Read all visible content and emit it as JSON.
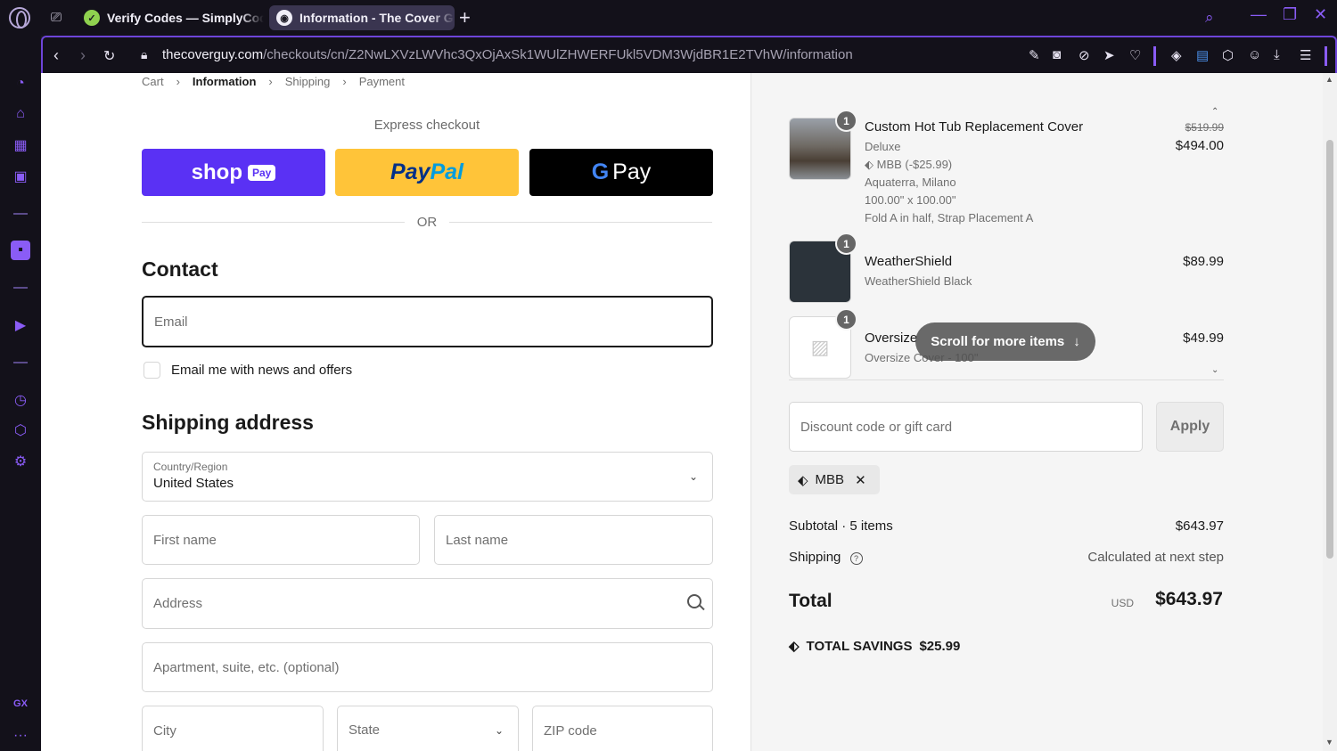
{
  "browser": {
    "tabs": [
      {
        "label": "Verify Codes — SimplyCodes"
      },
      {
        "label": "Information - The Cover Guy"
      }
    ],
    "url_domain": "thecoverguy.com",
    "url_path": "/checkouts/cn/Z2NwLXVzLWVhc3QxOjAxSk1WUlZHWERFUkl5VDM3WjdBR1E2TVhW/information",
    "accent_color": "#8a5cf6",
    "sidebar_label": "GX"
  },
  "breadcrumb": {
    "cart": "Cart",
    "information": "Information",
    "shipping": "Shipping",
    "payment": "Payment"
  },
  "express": {
    "heading": "Express checkout",
    "shop": "shop",
    "shop_tag": "Pay",
    "paypal_a": "Pay",
    "paypal_b": "Pal",
    "gpay_g": "G",
    "gpay": "Pay",
    "or": "OR"
  },
  "contact": {
    "heading": "Contact",
    "email_placeholder": "Email",
    "newsletter_label": "Email me with news and offers"
  },
  "shipping_address": {
    "heading": "Shipping address",
    "country_label": "Country/Region",
    "country_value": "United States",
    "first_name": "First name",
    "last_name": "Last name",
    "address": "Address",
    "apartment": "Apartment, suite, etc. (optional)",
    "city": "City",
    "state": "State",
    "zip": "ZIP code"
  },
  "order": {
    "items": [
      {
        "qty": "1",
        "title": "Custom Hot Tub Replacement Cover",
        "variant": "Deluxe",
        "discount": "MBB (-$25.99)",
        "line3": "Aquaterra, Milano",
        "line4": "100.00\" x 100.00\"",
        "line5": "Fold A in half, Strap Placement A",
        "old_price": "$519.99",
        "price": "$494.00"
      },
      {
        "qty": "1",
        "title": "WeatherShield",
        "variant": "WeatherShield Black",
        "price": "$89.99"
      },
      {
        "qty": "1",
        "title": "Oversize",
        "variant": "Oversize Cover - 100\"",
        "price": "$49.99"
      }
    ],
    "scroll_hint": "Scroll for more items",
    "discount_placeholder": "Discount code or gift card",
    "apply": "Apply",
    "applied_code": "MBB",
    "subtotal_label": "Subtotal · 5 items",
    "subtotal_value": "$643.97",
    "shipping_label": "Shipping",
    "shipping_value": "Calculated at next step",
    "total_label": "Total",
    "currency": "USD",
    "total_value": "$643.97",
    "savings_label": "TOTAL SAVINGS",
    "savings_value": "$25.99"
  }
}
